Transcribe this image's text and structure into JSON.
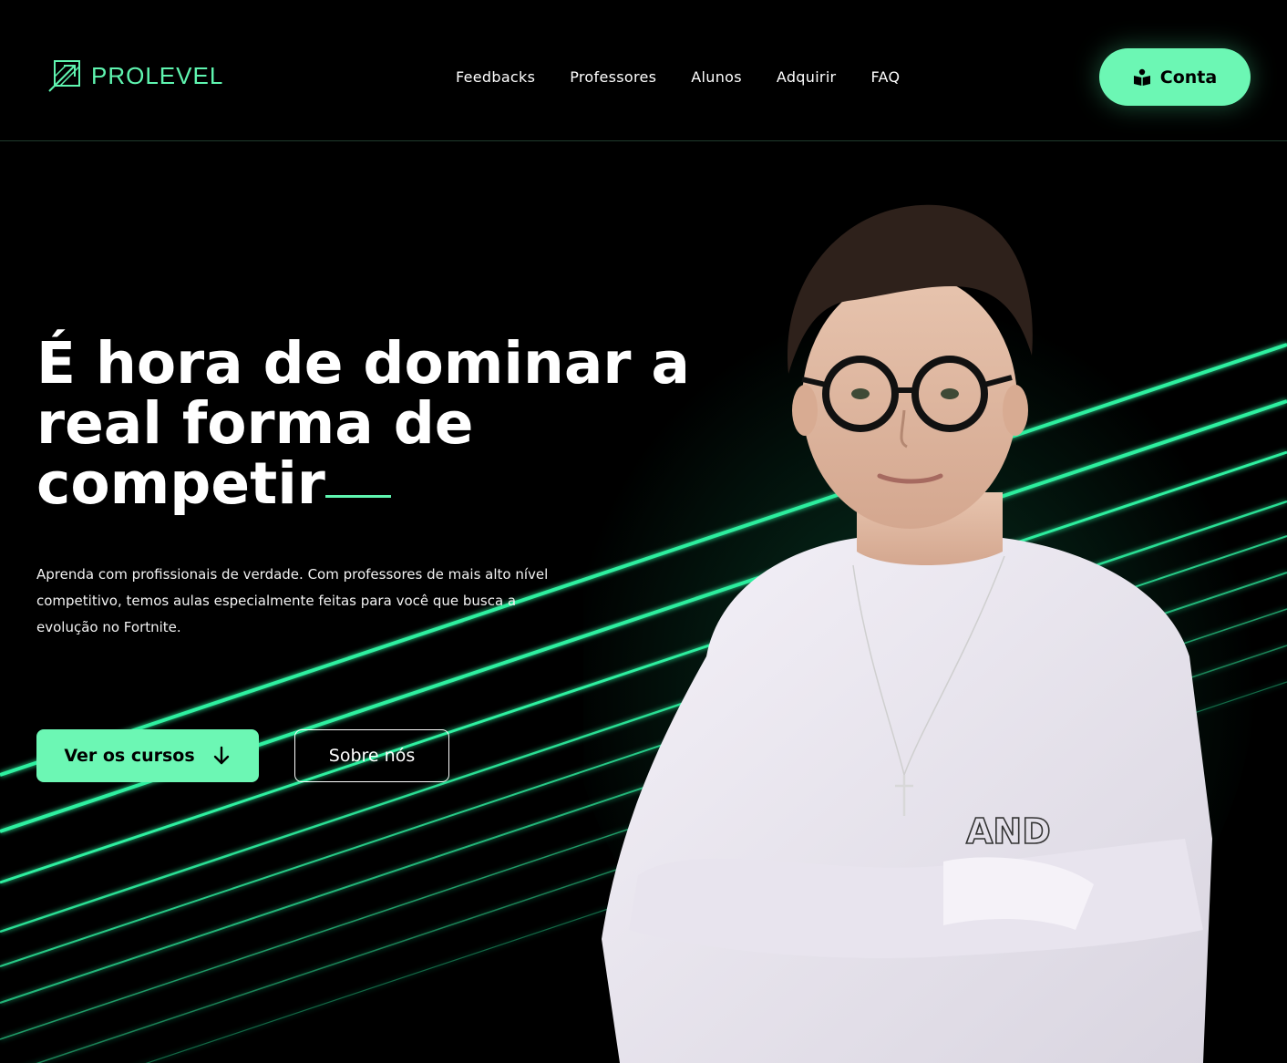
{
  "brand": {
    "name": "PROLEVEL",
    "accent": "#6cf7b4"
  },
  "nav": {
    "items": [
      {
        "label": "Feedbacks"
      },
      {
        "label": "Professores"
      },
      {
        "label": "Alunos"
      },
      {
        "label": "Adquirir"
      },
      {
        "label": "FAQ"
      }
    ]
  },
  "header": {
    "account_label": "Conta",
    "account_icon": "user-book-icon"
  },
  "hero": {
    "title_line1": "É hora de dominar a",
    "title_line2": "real forma de",
    "title_line3": "competir",
    "description": "Aprenda com profissionais de verdade. Com professores de mais alto nível competitivo, temos aulas especialmente feitas para você que busca a evolução no Fortnite.",
    "primary_button": "Ver os cursos",
    "primary_icon": "arrow-down-icon",
    "secondary_button": "Sobre nós",
    "shirt_text": "AND"
  }
}
